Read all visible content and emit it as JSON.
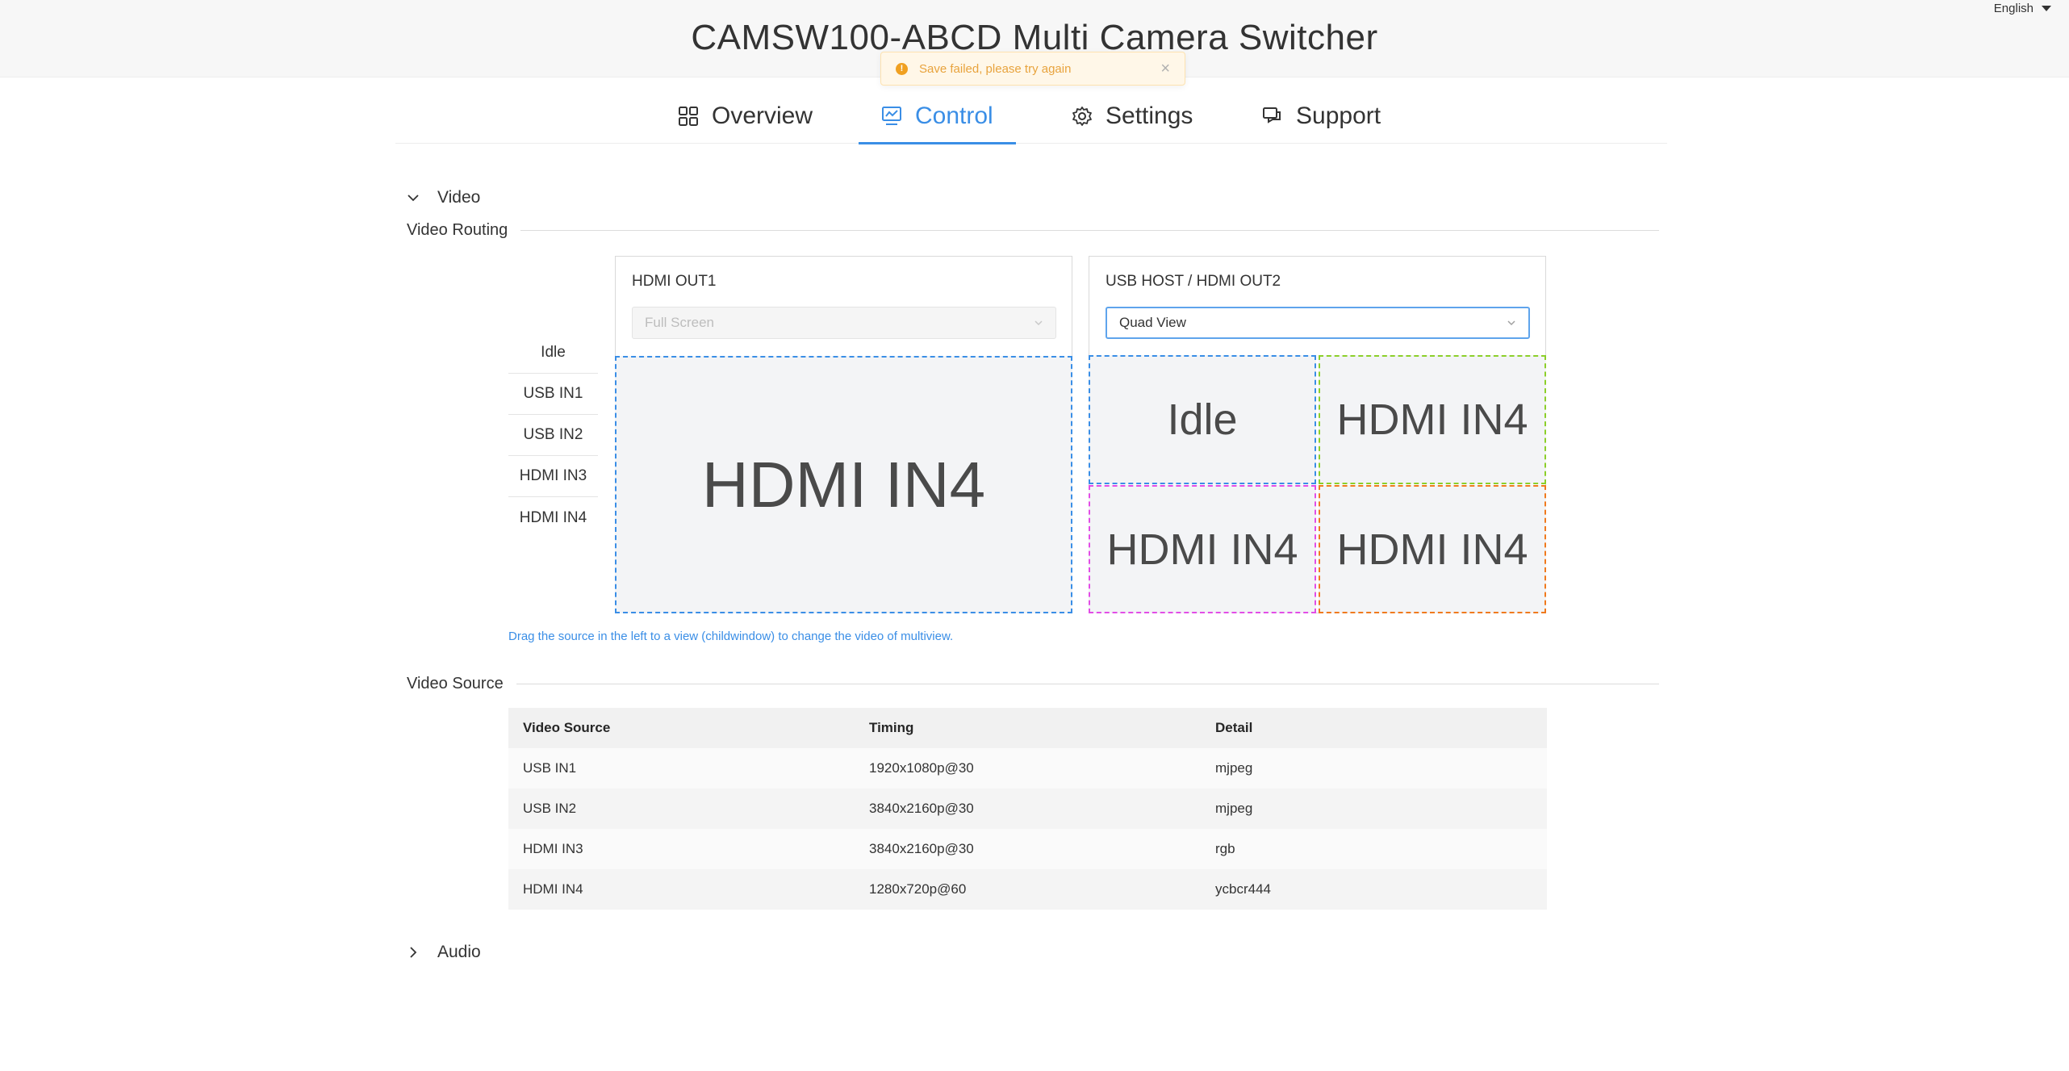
{
  "header": {
    "title": "CAMSW100-ABCD Multi Camera Switcher",
    "language": "English"
  },
  "toast": {
    "message": "Save failed, please try again",
    "close_glyph": "×"
  },
  "nav": {
    "tabs": [
      {
        "label": "Overview",
        "icon": "grid-icon"
      },
      {
        "label": "Control",
        "icon": "monitor-chart-icon",
        "active": true
      },
      {
        "label": "Settings",
        "icon": "gear-icon"
      },
      {
        "label": "Support",
        "icon": "chat-bubbles-icon"
      }
    ]
  },
  "video": {
    "collapse_label": "Video",
    "routing_title": "Video Routing",
    "sources": [
      "Idle",
      "USB IN1",
      "USB IN2",
      "HDMI IN3",
      "HDMI IN4"
    ],
    "out1": {
      "title": "HDMI OUT1",
      "mode": "Full Screen",
      "views": [
        "HDMI IN4"
      ]
    },
    "out2": {
      "title": "USB HOST / HDMI OUT2",
      "mode": "Quad View",
      "views": [
        "Idle",
        "HDMI IN4",
        "HDMI IN4",
        "HDMI IN4"
      ]
    },
    "hint": "Drag the source in the left to a view (childwindow) to change the video of multiview.",
    "source_title": "Video Source",
    "table": {
      "headers": [
        "Video Source",
        "Timing",
        "Detail"
      ],
      "rows": [
        [
          "USB IN1",
          "1920x1080p@30",
          "mjpeg"
        ],
        [
          "USB IN2",
          "3840x2160p@30",
          "mjpeg"
        ],
        [
          "HDMI IN3",
          "3840x2160p@30",
          "rgb"
        ],
        [
          "HDMI IN4",
          "1280x720p@60",
          "ycbcr444"
        ]
      ]
    }
  },
  "audio": {
    "collapse_label": "Audio"
  },
  "colors": {
    "accent": "#3a8ee6",
    "view_blue": "#3a8ee6",
    "view_green": "#8ccf2a",
    "view_magenta": "#e24de6",
    "view_orange": "#f07a1e",
    "view_red": "#e8473b",
    "warning": "#f0a020"
  }
}
